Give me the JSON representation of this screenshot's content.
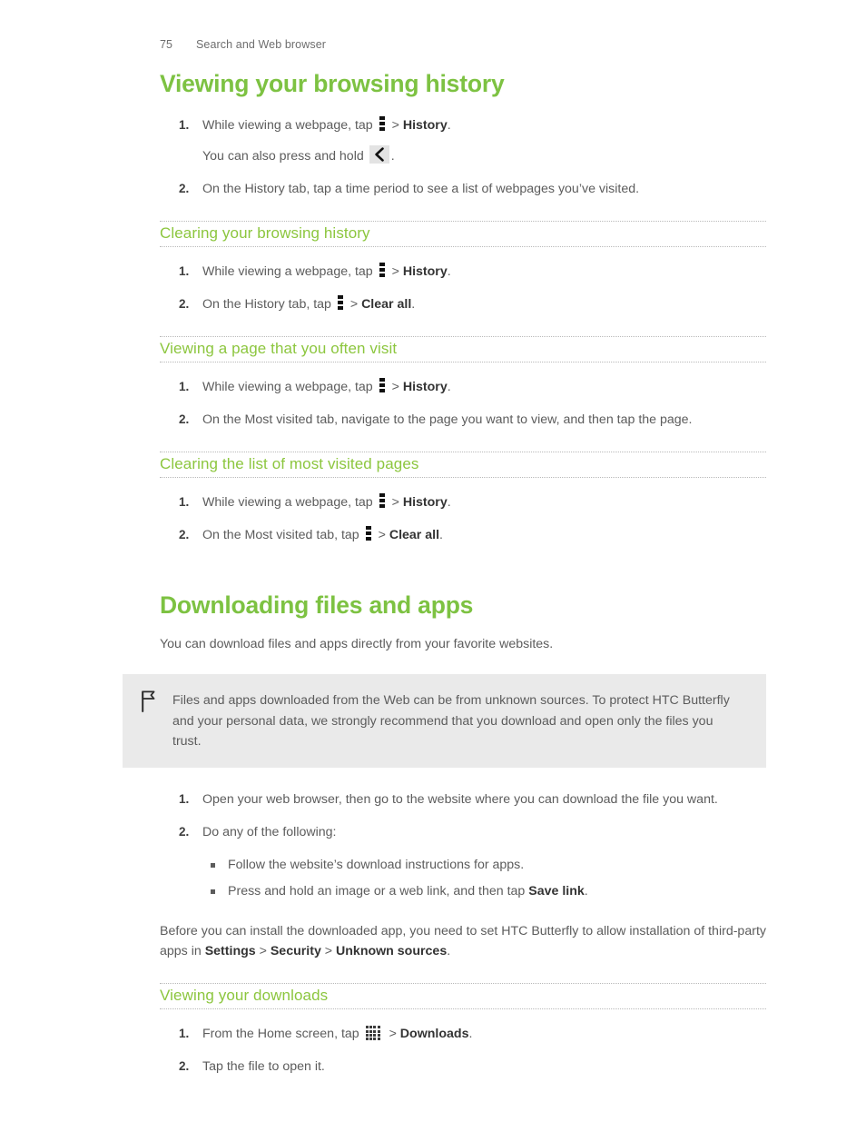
{
  "header": {
    "page_number": "75",
    "chapter": "Search and Web browser"
  },
  "colors": {
    "heading_green": "#7dc242",
    "subheading_green": "#8cc63e",
    "body_gray": "#5c5c5c",
    "note_background": "#eaeaea"
  },
  "icons": {
    "menu": "overflow-menu-icon",
    "back": "back-arrow-icon",
    "apps": "all-apps-grid-icon",
    "flag": "flag-note-icon"
  },
  "sections": [
    {
      "title": "Viewing your browsing history",
      "steps": [
        {
          "num": "1.",
          "parts": [
            {
              "t": "text",
              "v": "While viewing a webpage, tap "
            },
            {
              "t": "icon",
              "v": "menu"
            },
            {
              "t": "text",
              "v": " > "
            },
            {
              "t": "bold",
              "v": "History"
            },
            {
              "t": "text",
              "v": "."
            }
          ],
          "note": [
            {
              "t": "text",
              "v": "You can also press and hold "
            },
            {
              "t": "icon",
              "v": "back"
            },
            {
              "t": "text",
              "v": "."
            }
          ]
        },
        {
          "num": "2.",
          "parts": [
            {
              "t": "text",
              "v": "On the History tab, tap a time period to see a list of webpages you’ve visited."
            }
          ]
        }
      ],
      "subsections": [
        {
          "title": "Clearing your browsing history",
          "steps": [
            {
              "num": "1.",
              "parts": [
                {
                  "t": "text",
                  "v": "While viewing a webpage, tap "
                },
                {
                  "t": "icon",
                  "v": "menu"
                },
                {
                  "t": "text",
                  "v": " > "
                },
                {
                  "t": "bold",
                  "v": "History"
                },
                {
                  "t": "text",
                  "v": "."
                }
              ]
            },
            {
              "num": "2.",
              "parts": [
                {
                  "t": "text",
                  "v": "On the History tab, tap "
                },
                {
                  "t": "icon",
                  "v": "menu"
                },
                {
                  "t": "text",
                  "v": " > "
                },
                {
                  "t": "bold",
                  "v": "Clear all"
                },
                {
                  "t": "text",
                  "v": "."
                }
              ]
            }
          ]
        },
        {
          "title": "Viewing a page that you often visit",
          "steps": [
            {
              "num": "1.",
              "parts": [
                {
                  "t": "text",
                  "v": "While viewing a webpage, tap "
                },
                {
                  "t": "icon",
                  "v": "menu"
                },
                {
                  "t": "text",
                  "v": " > "
                },
                {
                  "t": "bold",
                  "v": "History"
                },
                {
                  "t": "text",
                  "v": "."
                }
              ]
            },
            {
              "num": "2.",
              "parts": [
                {
                  "t": "text",
                  "v": "On the Most visited tab, navigate to the page you want to view, and then tap the page."
                }
              ]
            }
          ]
        },
        {
          "title": "Clearing the list of most visited pages",
          "steps": [
            {
              "num": "1.",
              "parts": [
                {
                  "t": "text",
                  "v": "While viewing a webpage, tap "
                },
                {
                  "t": "icon",
                  "v": "menu"
                },
                {
                  "t": "text",
                  "v": " > "
                },
                {
                  "t": "bold",
                  "v": "History"
                },
                {
                  "t": "text",
                  "v": "."
                }
              ]
            },
            {
              "num": "2.",
              "parts": [
                {
                  "t": "text",
                  "v": "On the Most visited tab, tap "
                },
                {
                  "t": "icon",
                  "v": "menu"
                },
                {
                  "t": "text",
                  "v": " > "
                },
                {
                  "t": "bold",
                  "v": "Clear all"
                },
                {
                  "t": "text",
                  "v": "."
                }
              ]
            }
          ]
        }
      ]
    },
    {
      "title": "Downloading files and apps",
      "intro": "You can download files and apps directly from your favorite websites.",
      "note_box": "Files and apps downloaded from the Web can be from unknown sources. To protect HTC Butterfly and your personal data, we strongly recommend that you download and open only the files you trust.",
      "steps": [
        {
          "num": "1.",
          "parts": [
            {
              "t": "text",
              "v": "Open your web browser, then go to the website where you can download the file you want."
            }
          ]
        },
        {
          "num": "2.",
          "parts": [
            {
              "t": "text",
              "v": "Do any of the following:"
            }
          ],
          "bullets": [
            [
              {
                "t": "text",
                "v": "Follow the website’s download instructions for apps."
              }
            ],
            [
              {
                "t": "text",
                "v": "Press and hold an image or a web link, and then tap "
              },
              {
                "t": "bold",
                "v": "Save link"
              },
              {
                "t": "text",
                "v": "."
              }
            ]
          ]
        }
      ],
      "closing": [
        {
          "t": "text",
          "v": "Before you can install the downloaded app, you need to set HTC Butterfly to allow installation of third-party apps in "
        },
        {
          "t": "bold",
          "v": "Settings"
        },
        {
          "t": "text",
          "v": " > "
        },
        {
          "t": "bold",
          "v": "Security"
        },
        {
          "t": "text",
          "v": " > "
        },
        {
          "t": "bold",
          "v": "Unknown sources"
        },
        {
          "t": "text",
          "v": "."
        }
      ],
      "subsections": [
        {
          "title": "Viewing your downloads",
          "steps": [
            {
              "num": "1.",
              "parts": [
                {
                  "t": "text",
                  "v": "From the Home screen, tap "
                },
                {
                  "t": "icon",
                  "v": "apps"
                },
                {
                  "t": "text",
                  "v": " > "
                },
                {
                  "t": "bold",
                  "v": "Downloads"
                },
                {
                  "t": "text",
                  "v": "."
                }
              ]
            },
            {
              "num": "2.",
              "parts": [
                {
                  "t": "text",
                  "v": "Tap the file to open it."
                }
              ]
            }
          ]
        }
      ]
    }
  ]
}
